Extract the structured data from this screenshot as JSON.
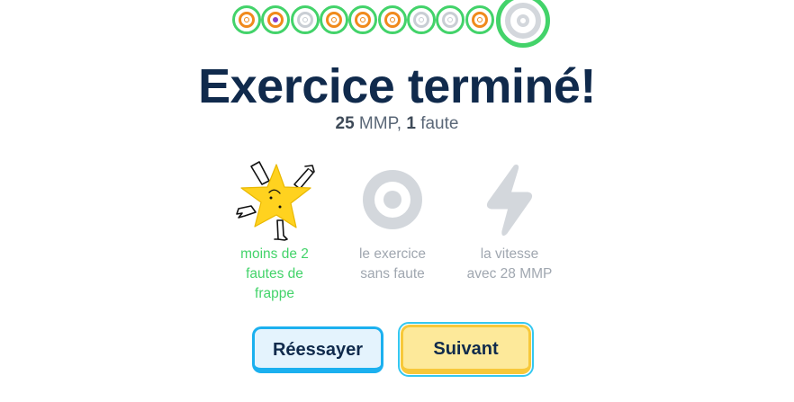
{
  "progress": {
    "dots": [
      {
        "state": "done",
        "ring": "orange"
      },
      {
        "state": "done",
        "ring": "purple"
      },
      {
        "state": "done",
        "ring": "gray"
      },
      {
        "state": "done",
        "ring": "orange"
      },
      {
        "state": "done",
        "ring": "orange"
      },
      {
        "state": "done",
        "ring": "orange"
      },
      {
        "state": "done",
        "ring": "gray"
      },
      {
        "state": "done",
        "ring": "gray"
      },
      {
        "state": "done",
        "ring": "orange"
      },
      {
        "state": "current",
        "ring": "gray"
      }
    ],
    "colors": {
      "green": "#43d36a",
      "orange": "#f08a1c",
      "purple": "#8a3cc9",
      "gray": "#c9ced4"
    }
  },
  "result": {
    "title": "Exercice terminé!",
    "wpm_value": "25",
    "wpm_unit": " MMP, ",
    "errors_value": "1",
    "errors_unit": " faute"
  },
  "achievements": [
    {
      "icon": "star-mascot-icon",
      "label_lines": [
        "moins de 2",
        "fautes de",
        "frappe"
      ],
      "earned": true
    },
    {
      "icon": "target-icon",
      "label_lines": [
        "le exercice",
        "sans faute"
      ],
      "earned": false
    },
    {
      "icon": "lightning-icon",
      "label_lines": [
        "la vitesse",
        "avec 28 MMP"
      ],
      "earned": false
    }
  ],
  "buttons": {
    "retry_label": "Réessayer",
    "next_label": "Suivant"
  },
  "theme": {
    "heading_color": "#102a4c",
    "earned_color": "#43d36a",
    "locked_color": "#a0a7b0",
    "icon_locked_color": "#d3d7dc",
    "star_color": "#ffd21f"
  }
}
